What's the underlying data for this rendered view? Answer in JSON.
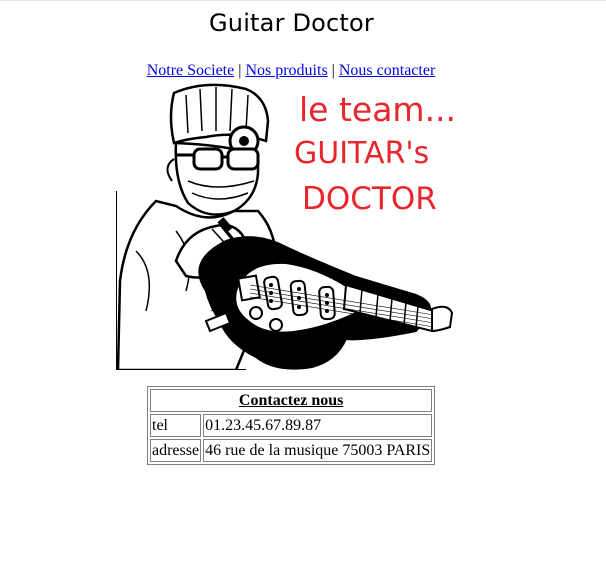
{
  "header": {
    "title": "Guitar Doctor"
  },
  "nav": {
    "items": [
      {
        "label": "Notre Societe"
      },
      {
        "label": "Nos produits"
      },
      {
        "label": "Nous contacter"
      }
    ],
    "separator": "|"
  },
  "logo": {
    "lines": [
      "le team...",
      "GUITAR's",
      "DOCTOR"
    ],
    "text_color": "#e8262b"
  },
  "contact": {
    "heading": "Contactez nous",
    "rows": [
      {
        "label": "tel",
        "value": "01.23.45.67.89.87"
      },
      {
        "label": "adresse",
        "value": "46 rue de la musique 75003 PARIS"
      }
    ]
  },
  "colors": {
    "link": "#0000ee",
    "table_border": "#808080"
  }
}
